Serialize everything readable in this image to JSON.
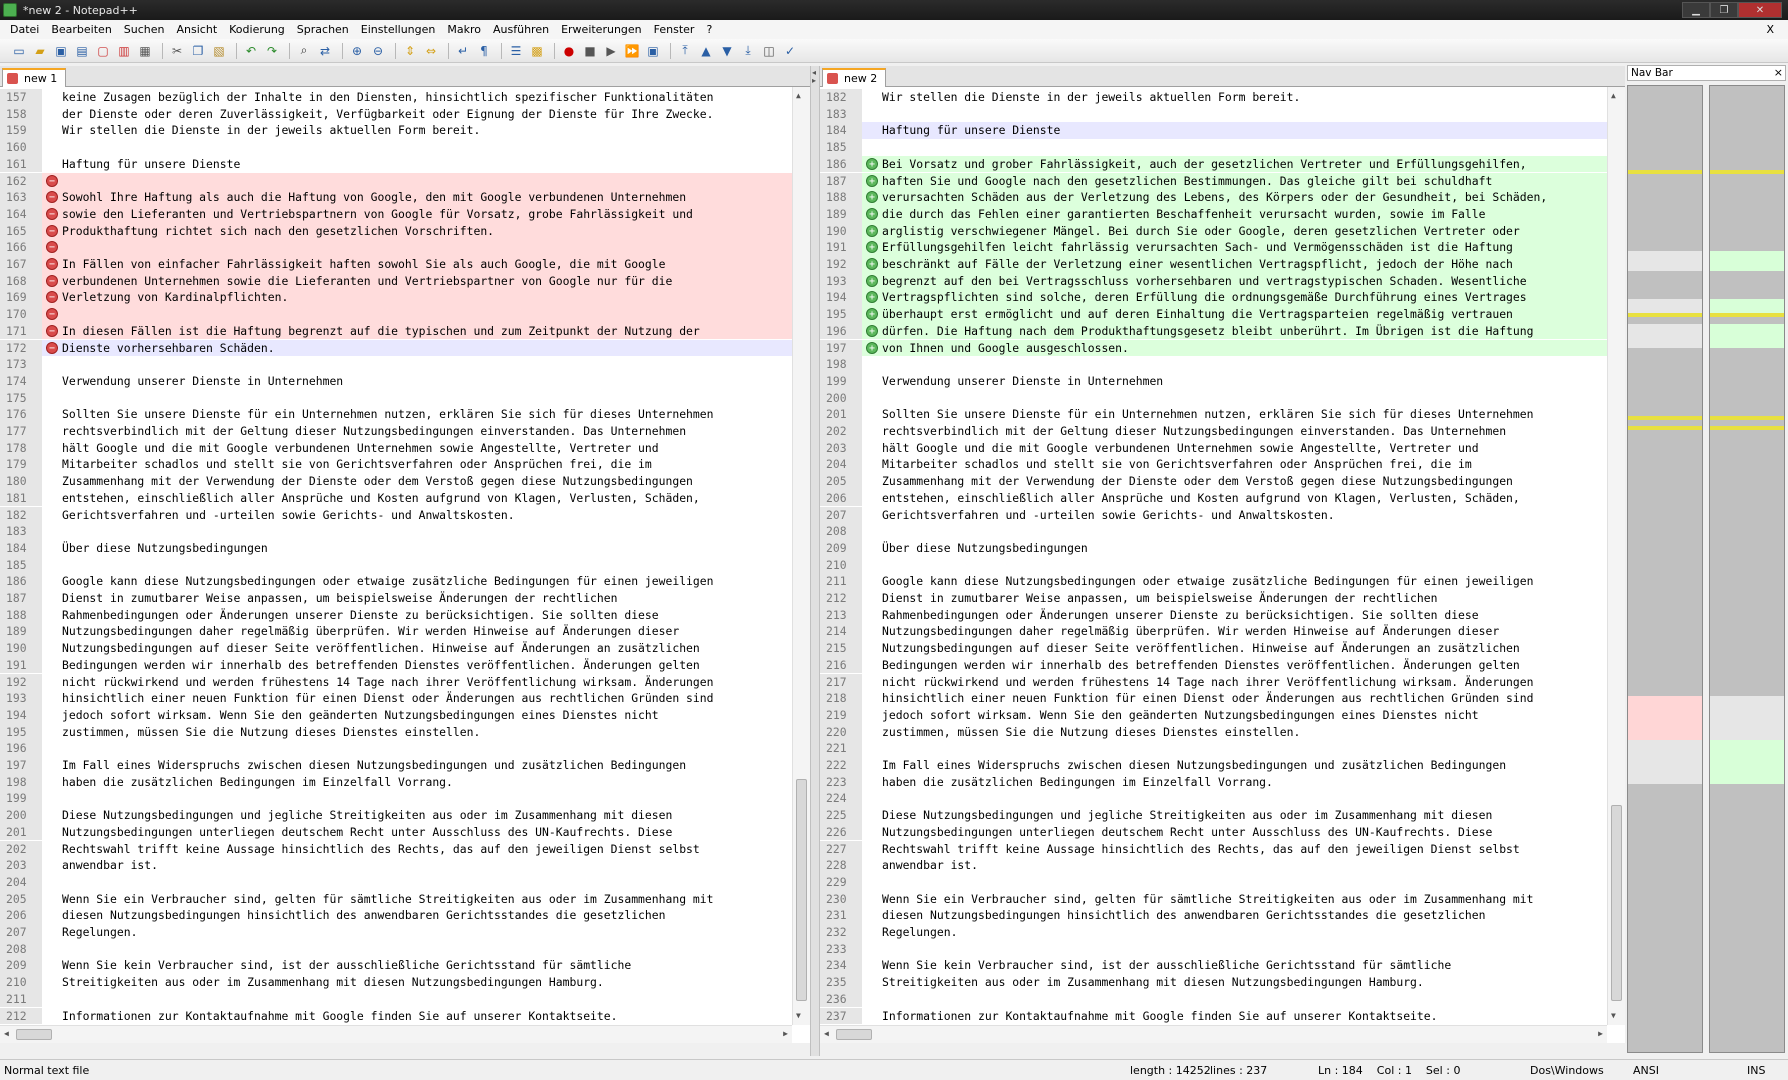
{
  "window": {
    "title": "*new 2 - Notepad++"
  },
  "menu": [
    "Datei",
    "Bearbeiten",
    "Suchen",
    "Ansicht",
    "Kodierung",
    "Sprachen",
    "Einstellungen",
    "Makro",
    "Ausführen",
    "Erweiterungen",
    "Fenster",
    "?"
  ],
  "menu_close": "X",
  "left_tab": {
    "label": "new 1"
  },
  "right_tab": {
    "label": "new 2"
  },
  "nav_bar": {
    "title": "Nav Bar",
    "close": "×"
  },
  "left_lines": [
    {
      "n": "157",
      "t": "keine Zusagen bezüglich der Inhalte in den Diensten, hinsichtlich spezifischer Funktionalitäten"
    },
    {
      "n": "158",
      "t": "der Dienste oder deren Zuverlässigkeit, Verfügbarkeit oder Eignung der Dienste für Ihre Zwecke."
    },
    {
      "n": "159",
      "t": "Wir stellen die Dienste in der jeweils aktuellen Form bereit."
    },
    {
      "n": "160",
      "t": ""
    },
    {
      "n": "161",
      "t": "Haftung für unsere Dienste"
    },
    {
      "n": "162",
      "t": "",
      "s": "rem"
    },
    {
      "n": "163",
      "t": "Sowohl Ihre Haftung als auch die Haftung von Google, den mit Google verbundenen Unternehmen",
      "s": "rem"
    },
    {
      "n": "164",
      "t": "sowie den Lieferanten und Vertriebspartnern von Google für Vorsatz, grobe Fahrlässigkeit und",
      "s": "rem"
    },
    {
      "n": "165",
      "t": "Produkthaftung richtet sich nach den gesetzlichen Vorschriften.",
      "s": "rem"
    },
    {
      "n": "166",
      "t": "",
      "s": "rem"
    },
    {
      "n": "167",
      "t": "In Fällen von einfacher Fahrlässigkeit haften sowohl Sie als auch Google, die mit Google",
      "s": "rem"
    },
    {
      "n": "168",
      "t": "verbundenen Unternehmen sowie die Lieferanten und Vertriebspartner von Google nur für die",
      "s": "rem"
    },
    {
      "n": "169",
      "t": "Verletzung von Kardinalpflichten.",
      "s": "rem"
    },
    {
      "n": "170",
      "t": "",
      "s": "rem"
    },
    {
      "n": "171",
      "t": "In diesen Fällen ist die Haftung begrenzt auf die typischen und zum Zeitpunkt der Nutzung der",
      "s": "rem"
    },
    {
      "n": "172",
      "t": "Dienste vorhersehbaren Schäden.",
      "s": "remcur"
    },
    {
      "n": "173",
      "t": ""
    },
    {
      "n": "174",
      "t": "Verwendung unserer Dienste in Unternehmen"
    },
    {
      "n": "175",
      "t": ""
    },
    {
      "n": "176",
      "t": "Sollten Sie unsere Dienste für ein Unternehmen nutzen, erklären Sie sich für dieses Unternehmen"
    },
    {
      "n": "177",
      "t": "rechtsverbindlich mit der Geltung dieser Nutzungsbedingungen einverstanden. Das Unternehmen"
    },
    {
      "n": "178",
      "t": "hält Google und die mit Google verbundenen Unternehmen sowie Angestellte, Vertreter und"
    },
    {
      "n": "179",
      "t": "Mitarbeiter schadlos und stellt sie von Gerichtsverfahren oder Ansprüchen frei, die im"
    },
    {
      "n": "180",
      "t": "Zusammenhang mit der Verwendung der Dienste oder dem Verstoß gegen diese Nutzungsbedingungen"
    },
    {
      "n": "181",
      "t": "entstehen, einschließlich aller Ansprüche und Kosten aufgrund von Klagen, Verlusten, Schäden,"
    },
    {
      "n": "182",
      "t": "Gerichtsverfahren und -urteilen sowie Gerichts- und Anwaltskosten."
    },
    {
      "n": "183",
      "t": ""
    },
    {
      "n": "184",
      "t": "Über diese Nutzungsbedingungen"
    },
    {
      "n": "185",
      "t": ""
    },
    {
      "n": "186",
      "t": "Google kann diese Nutzungsbedingungen oder etwaige zusätzliche Bedingungen für einen jeweiligen"
    },
    {
      "n": "187",
      "t": "Dienst in zumutbarer Weise anpassen, um beispielsweise Änderungen der rechtlichen"
    },
    {
      "n": "188",
      "t": "Rahmenbedingungen oder Änderungen unserer Dienste zu berücksichtigen. Sie sollten diese"
    },
    {
      "n": "189",
      "t": "Nutzungsbedingungen daher regelmäßig überprüfen. Wir werden Hinweise auf Änderungen dieser"
    },
    {
      "n": "190",
      "t": "Nutzungsbedingungen auf dieser Seite veröffentlichen. Hinweise auf Änderungen an zusätzlichen"
    },
    {
      "n": "191",
      "t": "Bedingungen werden wir innerhalb des betreffenden Dienstes veröffentlichen. Änderungen gelten"
    },
    {
      "n": "192",
      "t": "nicht rückwirkend und werden frühestens 14 Tage nach ihrer Veröffentlichung wirksam. Änderungen"
    },
    {
      "n": "193",
      "t": "hinsichtlich einer neuen Funktion für einen Dienst oder Änderungen aus rechtlichen Gründen sind"
    },
    {
      "n": "194",
      "t": "jedoch sofort wirksam. Wenn Sie den geänderten Nutzungsbedingungen eines Dienstes nicht"
    },
    {
      "n": "195",
      "t": "zustimmen, müssen Sie die Nutzung dieses Dienstes einstellen."
    },
    {
      "n": "196",
      "t": ""
    },
    {
      "n": "197",
      "t": "Im Fall eines Widerspruchs zwischen diesen Nutzungsbedingungen und zusätzlichen Bedingungen"
    },
    {
      "n": "198",
      "t": "haben die zusätzlichen Bedingungen im Einzelfall Vorrang."
    },
    {
      "n": "199",
      "t": ""
    },
    {
      "n": "200",
      "t": "Diese Nutzungsbedingungen und jegliche Streitigkeiten aus oder im Zusammenhang mit diesen"
    },
    {
      "n": "201",
      "t": "Nutzungsbedingungen unterliegen deutschem Recht unter Ausschluss des UN-Kaufrechts. Diese"
    },
    {
      "n": "202",
      "t": "Rechtswahl trifft keine Aussage hinsichtlich des Rechts, das auf den jeweiligen Dienst selbst"
    },
    {
      "n": "203",
      "t": "anwendbar ist."
    },
    {
      "n": "204",
      "t": ""
    },
    {
      "n": "205",
      "t": "Wenn Sie ein Verbraucher sind, gelten für sämtliche Streitigkeiten aus oder im Zusammenhang mit"
    },
    {
      "n": "206",
      "t": "diesen Nutzungsbedingungen hinsichtlich des anwendbaren Gerichtsstandes die gesetzlichen"
    },
    {
      "n": "207",
      "t": "Regelungen."
    },
    {
      "n": "208",
      "t": ""
    },
    {
      "n": "209",
      "t": "Wenn Sie kein Verbraucher sind, ist der ausschließliche Gerichtsstand für sämtliche"
    },
    {
      "n": "210",
      "t": "Streitigkeiten aus oder im Zusammenhang mit diesen Nutzungsbedingungen Hamburg."
    },
    {
      "n": "211",
      "t": ""
    },
    {
      "n": "212",
      "t": "Informationen zur Kontaktaufnahme mit Google finden Sie auf unserer Kontaktseite."
    }
  ],
  "right_lines": [
    {
      "n": "182",
      "t": "Wir stellen die Dienste in der jeweils aktuellen Form bereit."
    },
    {
      "n": "183",
      "t": ""
    },
    {
      "n": "184",
      "t": "Haftung für unsere Dienste",
      "s": "cur"
    },
    {
      "n": "185",
      "t": ""
    },
    {
      "n": "186",
      "t": "Bei Vorsatz und grober Fahrlässigkeit, auch der gesetzlichen Vertreter und Erfüllungsgehilfen,",
      "s": "add"
    },
    {
      "n": "187",
      "t": "haften Sie und Google nach den gesetzlichen Bestimmungen. Das gleiche gilt bei schuldhaft",
      "s": "add"
    },
    {
      "n": "188",
      "t": "verursachten Schäden aus der Verletzung des Lebens, des Körpers oder der Gesundheit, bei Schäden,",
      "s": "add"
    },
    {
      "n": "189",
      "t": "die durch das Fehlen einer garantierten Beschaffenheit verursacht wurden, sowie im Falle",
      "s": "add"
    },
    {
      "n": "190",
      "t": "arglistig verschwiegener Mängel. Bei durch Sie oder Google, deren gesetzlichen Vertreter oder",
      "s": "add"
    },
    {
      "n": "191",
      "t": "Erfüllungsgehilfen leicht fahrlässig verursachten Sach- und Vermögensschäden ist die Haftung",
      "s": "add"
    },
    {
      "n": "192",
      "t": "beschränkt auf Fälle der Verletzung einer wesentlichen Vertragspflicht, jedoch der Höhe nach",
      "s": "add"
    },
    {
      "n": "193",
      "t": "begrenzt auf den bei Vertragsschluss vorhersehbaren und vertragstypischen Schaden. Wesentliche",
      "s": "add"
    },
    {
      "n": "194",
      "t": "Vertragspflichten sind solche, deren Erfüllung die ordnungsgemäße Durchführung eines Vertrages",
      "s": "add"
    },
    {
      "n": "195",
      "t": "überhaupt erst ermöglicht und auf deren Einhaltung die Vertragsparteien regelmäßig vertrauen",
      "s": "add"
    },
    {
      "n": "196",
      "t": "dürfen. Die Haftung nach dem Produkthaftungsgesetz bleibt unberührt. Im Übrigen ist die Haftung",
      "s": "add"
    },
    {
      "n": "197",
      "t": "von Ihnen und Google ausgeschlossen.",
      "s": "add"
    },
    {
      "n": "198",
      "t": ""
    },
    {
      "n": "199",
      "t": "Verwendung unserer Dienste in Unternehmen"
    },
    {
      "n": "200",
      "t": ""
    },
    {
      "n": "201",
      "t": "Sollten Sie unsere Dienste für ein Unternehmen nutzen, erklären Sie sich für dieses Unternehmen"
    },
    {
      "n": "202",
      "t": "rechtsverbindlich mit der Geltung dieser Nutzungsbedingungen einverstanden. Das Unternehmen"
    },
    {
      "n": "203",
      "t": "hält Google und die mit Google verbundenen Unternehmen sowie Angestellte, Vertreter und"
    },
    {
      "n": "204",
      "t": "Mitarbeiter schadlos und stellt sie von Gerichtsverfahren oder Ansprüchen frei, die im"
    },
    {
      "n": "205",
      "t": "Zusammenhang mit der Verwendung der Dienste oder dem Verstoß gegen diese Nutzungsbedingungen"
    },
    {
      "n": "206",
      "t": "entstehen, einschließlich aller Ansprüche und Kosten aufgrund von Klagen, Verlusten, Schäden,"
    },
    {
      "n": "207",
      "t": "Gerichtsverfahren und -urteilen sowie Gerichts- und Anwaltskosten."
    },
    {
      "n": "208",
      "t": ""
    },
    {
      "n": "209",
      "t": "Über diese Nutzungsbedingungen"
    },
    {
      "n": "210",
      "t": ""
    },
    {
      "n": "211",
      "t": "Google kann diese Nutzungsbedingungen oder etwaige zusätzliche Bedingungen für einen jeweiligen"
    },
    {
      "n": "212",
      "t": "Dienst in zumutbarer Weise anpassen, um beispielsweise Änderungen der rechtlichen"
    },
    {
      "n": "213",
      "t": "Rahmenbedingungen oder Änderungen unserer Dienste zu berücksichtigen. Sie sollten diese"
    },
    {
      "n": "214",
      "t": "Nutzungsbedingungen daher regelmäßig überprüfen. Wir werden Hinweise auf Änderungen dieser"
    },
    {
      "n": "215",
      "t": "Nutzungsbedingungen auf dieser Seite veröffentlichen. Hinweise auf Änderungen an zusätzlichen"
    },
    {
      "n": "216",
      "t": "Bedingungen werden wir innerhalb des betreffenden Dienstes veröffentlichen. Änderungen gelten"
    },
    {
      "n": "217",
      "t": "nicht rückwirkend und werden frühestens 14 Tage nach ihrer Veröffentlichung wirksam. Änderungen"
    },
    {
      "n": "218",
      "t": "hinsichtlich einer neuen Funktion für einen Dienst oder Änderungen aus rechtlichen Gründen sind"
    },
    {
      "n": "219",
      "t": "jedoch sofort wirksam. Wenn Sie den geänderten Nutzungsbedingungen eines Dienstes nicht"
    },
    {
      "n": "220",
      "t": "zustimmen, müssen Sie die Nutzung dieses Dienstes einstellen."
    },
    {
      "n": "221",
      "t": ""
    },
    {
      "n": "222",
      "t": "Im Fall eines Widerspruchs zwischen diesen Nutzungsbedingungen und zusätzlichen Bedingungen"
    },
    {
      "n": "223",
      "t": "haben die zusätzlichen Bedingungen im Einzelfall Vorrang."
    },
    {
      "n": "224",
      "t": ""
    },
    {
      "n": "225",
      "t": "Diese Nutzungsbedingungen und jegliche Streitigkeiten aus oder im Zusammenhang mit diesen"
    },
    {
      "n": "226",
      "t": "Nutzungsbedingungen unterliegen deutschem Recht unter Ausschluss des UN-Kaufrechts. Diese"
    },
    {
      "n": "227",
      "t": "Rechtswahl trifft keine Aussage hinsichtlich des Rechts, das auf den jeweiligen Dienst selbst"
    },
    {
      "n": "228",
      "t": "anwendbar ist."
    },
    {
      "n": "229",
      "t": ""
    },
    {
      "n": "230",
      "t": "Wenn Sie ein Verbraucher sind, gelten für sämtliche Streitigkeiten aus oder im Zusammenhang mit"
    },
    {
      "n": "231",
      "t": "diesen Nutzungsbedingungen hinsichtlich des anwendbaren Gerichtsstandes die gesetzlichen"
    },
    {
      "n": "232",
      "t": "Regelungen."
    },
    {
      "n": "233",
      "t": ""
    },
    {
      "n": "234",
      "t": "Wenn Sie kein Verbraucher sind, ist der ausschließliche Gerichtsstand für sämtliche"
    },
    {
      "n": "235",
      "t": "Streitigkeiten aus oder im Zusammenhang mit diesen Nutzungsbedingungen Hamburg."
    },
    {
      "n": "236",
      "t": ""
    },
    {
      "n": "237",
      "t": "Informationen zur Kontaktaufnahme mit Google finden Sie auf unserer Kontaktseite."
    }
  ],
  "status": {
    "filetype": "Normal text file",
    "length": "length : 14252",
    "lines": "lines : 237",
    "position": "Ln : 184    Col : 1    Sel : 0",
    "eol": "Dos\\Windows",
    "encoding": "ANSI",
    "mode": "INS"
  },
  "colors": {
    "removed": "#ffdcdc",
    "added": "#dcffdc",
    "current_line": "#e8e8ff",
    "nav_changed": "#e8e040",
    "nav_removed": "#ffd6d6",
    "nav_added": "#d8ffd8"
  }
}
